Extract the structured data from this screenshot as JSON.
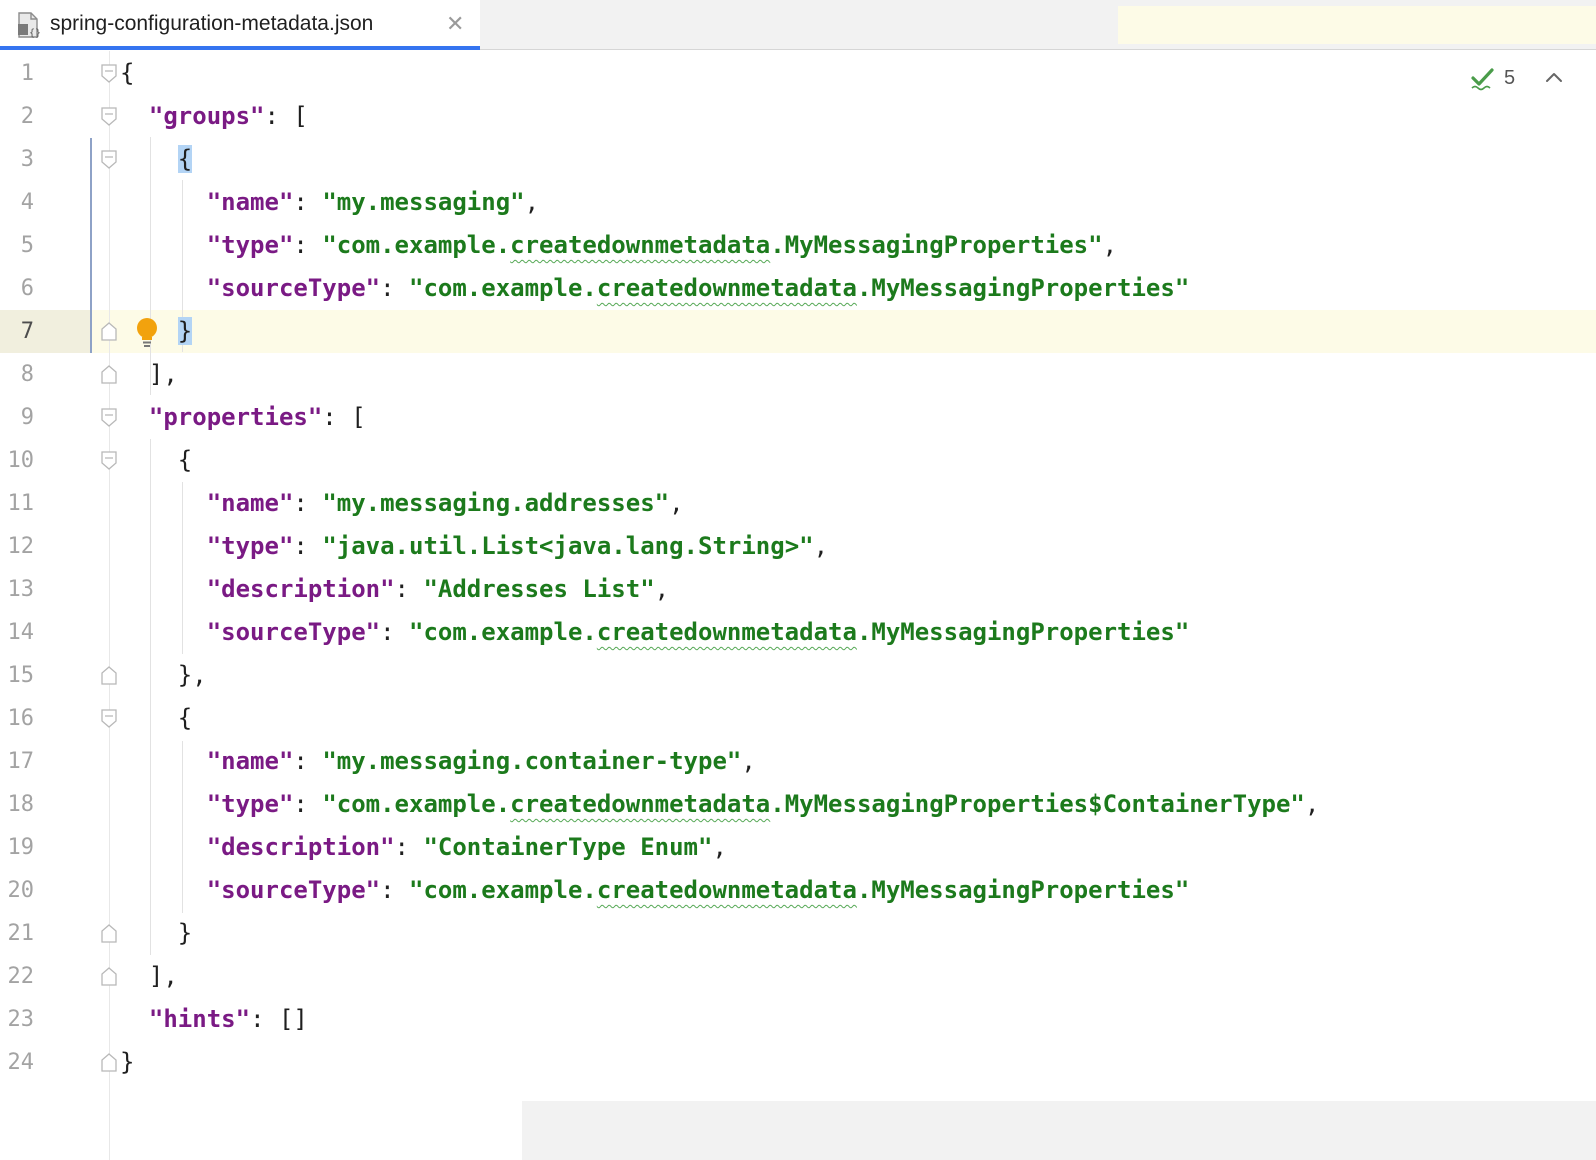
{
  "tab": {
    "title": "spring-configuration-metadata.json",
    "close_glyph": "✕",
    "icon": "json-file-icon"
  },
  "inspections": {
    "count": "5",
    "icon": "check-icon",
    "nav_icon": "chevron-up-icon"
  },
  "colors": {
    "key": "#7a1a84",
    "string": "#1c7a1c",
    "accent": "#3574f0",
    "active_line": "#fdfbe7"
  },
  "active_line": 7,
  "lines": [
    {
      "num": "1",
      "tokens": [
        {
          "t": "{",
          "c": "p"
        }
      ]
    },
    {
      "num": "2",
      "tokens": [
        {
          "t": "  ",
          "c": "p"
        },
        {
          "t": "\"groups\"",
          "c": "k"
        },
        {
          "t": ": [",
          "c": "p"
        }
      ]
    },
    {
      "num": "3",
      "tokens": [
        {
          "t": "    ",
          "c": "p"
        },
        {
          "t": "{",
          "c": "p",
          "hl": true
        }
      ]
    },
    {
      "num": "4",
      "tokens": [
        {
          "t": "      ",
          "c": "p"
        },
        {
          "t": "\"name\"",
          "c": "k"
        },
        {
          "t": ": ",
          "c": "p"
        },
        {
          "t": "\"my.messaging\"",
          "c": "s"
        },
        {
          "t": ",",
          "c": "p"
        }
      ]
    },
    {
      "num": "5",
      "tokens": [
        {
          "t": "      ",
          "c": "p"
        },
        {
          "t": "\"type\"",
          "c": "k"
        },
        {
          "t": ": ",
          "c": "p"
        },
        {
          "t": "\"com.example.",
          "c": "s"
        },
        {
          "t": "createdownmetadata",
          "c": "s",
          "wavy": true
        },
        {
          "t": ".MyMessagingProperties\"",
          "c": "s"
        },
        {
          "t": ",",
          "c": "p"
        }
      ]
    },
    {
      "num": "6",
      "tokens": [
        {
          "t": "      ",
          "c": "p"
        },
        {
          "t": "\"sourceType\"",
          "c": "k"
        },
        {
          "t": ": ",
          "c": "p"
        },
        {
          "t": "\"com.example.",
          "c": "s"
        },
        {
          "t": "createdownmetadata",
          "c": "s",
          "wavy": true
        },
        {
          "t": ".MyMessagingProperties\"",
          "c": "s"
        }
      ]
    },
    {
      "num": "7",
      "tokens": [
        {
          "t": "    ",
          "c": "p"
        },
        {
          "t": "}",
          "c": "p",
          "hl": true
        }
      ]
    },
    {
      "num": "8",
      "tokens": [
        {
          "t": "  ],",
          "c": "p"
        }
      ]
    },
    {
      "num": "9",
      "tokens": [
        {
          "t": "  ",
          "c": "p"
        },
        {
          "t": "\"properties\"",
          "c": "k"
        },
        {
          "t": ": [",
          "c": "p"
        }
      ]
    },
    {
      "num": "10",
      "tokens": [
        {
          "t": "    {",
          "c": "p"
        }
      ]
    },
    {
      "num": "11",
      "tokens": [
        {
          "t": "      ",
          "c": "p"
        },
        {
          "t": "\"name\"",
          "c": "k"
        },
        {
          "t": ": ",
          "c": "p"
        },
        {
          "t": "\"my.messaging.addresses\"",
          "c": "s"
        },
        {
          "t": ",",
          "c": "p"
        }
      ]
    },
    {
      "num": "12",
      "tokens": [
        {
          "t": "      ",
          "c": "p"
        },
        {
          "t": "\"type\"",
          "c": "k"
        },
        {
          "t": ": ",
          "c": "p"
        },
        {
          "t": "\"java.util.List<java.lang.String>\"",
          "c": "s"
        },
        {
          "t": ",",
          "c": "p"
        }
      ]
    },
    {
      "num": "13",
      "tokens": [
        {
          "t": "      ",
          "c": "p"
        },
        {
          "t": "\"description\"",
          "c": "k"
        },
        {
          "t": ": ",
          "c": "p"
        },
        {
          "t": "\"Addresses List\"",
          "c": "s"
        },
        {
          "t": ",",
          "c": "p"
        }
      ]
    },
    {
      "num": "14",
      "tokens": [
        {
          "t": "      ",
          "c": "p"
        },
        {
          "t": "\"sourceType\"",
          "c": "k"
        },
        {
          "t": ": ",
          "c": "p"
        },
        {
          "t": "\"com.example.",
          "c": "s"
        },
        {
          "t": "createdownmetadata",
          "c": "s",
          "wavy": true
        },
        {
          "t": ".MyMessagingProperties\"",
          "c": "s"
        }
      ]
    },
    {
      "num": "15",
      "tokens": [
        {
          "t": "    },",
          "c": "p"
        }
      ]
    },
    {
      "num": "16",
      "tokens": [
        {
          "t": "    {",
          "c": "p"
        }
      ]
    },
    {
      "num": "17",
      "tokens": [
        {
          "t": "      ",
          "c": "p"
        },
        {
          "t": "\"name\"",
          "c": "k"
        },
        {
          "t": ": ",
          "c": "p"
        },
        {
          "t": "\"my.messaging.container-type\"",
          "c": "s"
        },
        {
          "t": ",",
          "c": "p"
        }
      ]
    },
    {
      "num": "18",
      "tokens": [
        {
          "t": "      ",
          "c": "p"
        },
        {
          "t": "\"type\"",
          "c": "k"
        },
        {
          "t": ": ",
          "c": "p"
        },
        {
          "t": "\"com.example.",
          "c": "s"
        },
        {
          "t": "createdownmetadata",
          "c": "s",
          "wavy": true
        },
        {
          "t": ".MyMessagingProperties$ContainerType\"",
          "c": "s"
        },
        {
          "t": ",",
          "c": "p"
        }
      ]
    },
    {
      "num": "19",
      "tokens": [
        {
          "t": "      ",
          "c": "p"
        },
        {
          "t": "\"description\"",
          "c": "k"
        },
        {
          "t": ": ",
          "c": "p"
        },
        {
          "t": "\"ContainerType Enum\"",
          "c": "s"
        },
        {
          "t": ",",
          "c": "p"
        }
      ]
    },
    {
      "num": "20",
      "tokens": [
        {
          "t": "      ",
          "c": "p"
        },
        {
          "t": "\"sourceType\"",
          "c": "k"
        },
        {
          "t": ": ",
          "c": "p"
        },
        {
          "t": "\"com.example.",
          "c": "s"
        },
        {
          "t": "createdownmetadata",
          "c": "s",
          "wavy": true
        },
        {
          "t": ".MyMessagingProperties\"",
          "c": "s"
        }
      ]
    },
    {
      "num": "21",
      "tokens": [
        {
          "t": "    }",
          "c": "p"
        }
      ]
    },
    {
      "num": "22",
      "tokens": [
        {
          "t": "  ],",
          "c": "p"
        }
      ]
    },
    {
      "num": "23",
      "tokens": [
        {
          "t": "  ",
          "c": "p"
        },
        {
          "t": "\"hints\"",
          "c": "k"
        },
        {
          "t": ": []",
          "c": "p"
        }
      ]
    },
    {
      "num": "24",
      "tokens": [
        {
          "t": "}",
          "c": "p"
        }
      ]
    }
  ],
  "fold_markers": {
    "1": "open",
    "2": "open",
    "3": "open",
    "7": "close",
    "8": "close",
    "9": "open",
    "10": "open",
    "15": "close",
    "16": "open",
    "21": "close",
    "22": "close",
    "24": "close"
  }
}
